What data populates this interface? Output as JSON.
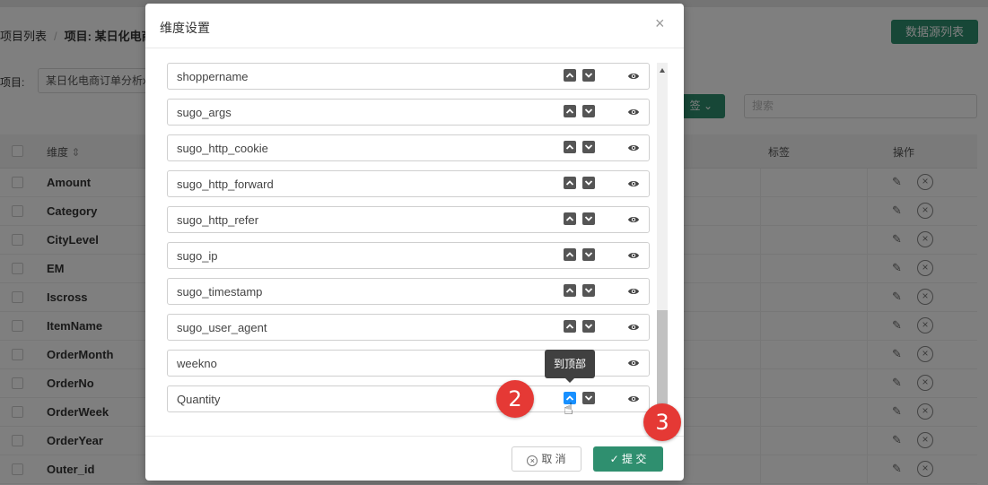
{
  "breadcrumb": {
    "root": "项目列表",
    "current": "项目: 某日化电商"
  },
  "header": {
    "datasource_button": "数据源列表"
  },
  "filter": {
    "project_label": "项目:",
    "project_value": "某日化电商订单分析x",
    "tag_button": "签",
    "search_placeholder": "搜索"
  },
  "table": {
    "columns": {
      "dimension": "维度",
      "tag": "标签",
      "actions": "操作"
    },
    "rows": [
      "Amount",
      "Category",
      "CityLevel",
      "EM",
      "Iscross",
      "ItemName",
      "OrderMonth",
      "OrderNo",
      "OrderWeek",
      "OrderYear",
      "Outer_id"
    ]
  },
  "modal": {
    "title": "维度设置",
    "close": "×",
    "items": [
      "shoppername",
      "sugo_args",
      "sugo_http_cookie",
      "sugo_http_forward",
      "sugo_http_refer",
      "sugo_ip",
      "sugo_timestamp",
      "sugo_user_agent",
      "weekno",
      "Quantity"
    ],
    "tooltip": "到顶部",
    "cancel_label": "取 消",
    "submit_label": "提 交"
  },
  "annotations": {
    "step2": "2",
    "step3": "3"
  },
  "colors": {
    "primary_green": "#2f8f6f",
    "active_blue": "#1890ff",
    "badge_red": "#e53935"
  }
}
